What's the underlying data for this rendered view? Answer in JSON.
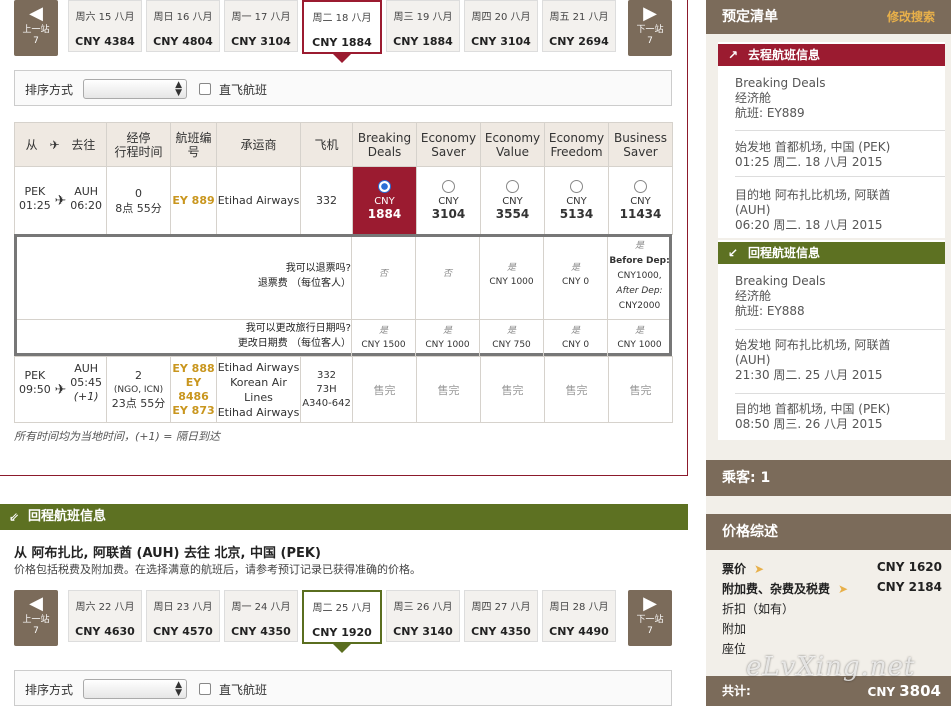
{
  "outbound_dates": {
    "prev_label": "上一站",
    "prev_num": "7",
    "next_label": "下一站",
    "next_num": "7",
    "items": [
      {
        "date": "周六 15 八月",
        "price": "CNY 4384"
      },
      {
        "date": "周日 16 八月",
        "price": "CNY 4804"
      },
      {
        "date": "周一 17 八月",
        "price": "CNY 3104"
      },
      {
        "date": "周二 18 八月",
        "price": "CNY 1884"
      },
      {
        "date": "周三 19 八月",
        "price": "CNY 1884"
      },
      {
        "date": "周四 20 八月",
        "price": "CNY 3104"
      },
      {
        "date": "周五 21 八月",
        "price": "CNY 2694"
      }
    ]
  },
  "sort": {
    "label": "排序方式",
    "direct_label": "直飞航班"
  },
  "table": {
    "h_from": "从",
    "h_to": "去往",
    "h_stops": "经停",
    "h_duration": "行程时间",
    "h_flightno": "航班编号",
    "h_carrier": "承运商",
    "h_aircraft": "飞机",
    "fares": [
      {
        "l1": "Breaking",
        "l2": "Deals"
      },
      {
        "l1": "Economy",
        "l2": "Saver"
      },
      {
        "l1": "Economy",
        "l2": "Value"
      },
      {
        "l1": "Economy",
        "l2": "Freedom"
      },
      {
        "l1": "Business",
        "l2": "Saver"
      }
    ],
    "row1": {
      "from": "PEK",
      "dep": "01:25",
      "to": "AUH",
      "arr": "06:20",
      "stops": "0",
      "duration": "8点 55分",
      "flight": "EY 889",
      "carrier": "Etihad Airways",
      "aircraft": "332",
      "prices": [
        {
          "cur": "CNY",
          "amt": "1884"
        },
        {
          "cur": "CNY",
          "amt": "3104"
        },
        {
          "cur": "CNY",
          "amt": "3554"
        },
        {
          "cur": "CNY",
          "amt": "5134"
        },
        {
          "cur": "CNY",
          "amt": "11434"
        }
      ]
    },
    "rules": {
      "refund_q": "我可以退票吗?",
      "refund_fee": "退票费 （每位客人）",
      "change_q": "我可以更改旅行日期吗?",
      "change_fee": "更改日期费 （每位客人）",
      "refund": [
        {
          "yn": "否",
          "fee": ""
        },
        {
          "yn": "否",
          "fee": ""
        },
        {
          "yn": "是",
          "fee": "CNY 1000"
        },
        {
          "yn": "是",
          "fee": "CNY 0"
        },
        {
          "yn": "是",
          "fee": "Before Dep: CNY1000, After Dep: CNY2000"
        }
      ],
      "change": [
        {
          "yn": "是",
          "fee": "CNY 1500"
        },
        {
          "yn": "是",
          "fee": "CNY 1000"
        },
        {
          "yn": "是",
          "fee": "CNY 750"
        },
        {
          "yn": "是",
          "fee": "CNY 0"
        },
        {
          "yn": "是",
          "fee": "CNY 1000"
        }
      ],
      "before_dep": "Before Dep:",
      "before_val": "CNY1000,",
      "after_dep": "After Dep:",
      "after_val": "CNY2000"
    },
    "row2": {
      "from": "PEK",
      "dep": "09:50",
      "to": "AUH",
      "arr": "05:45",
      "arr_note": "(+1)",
      "stops": "2",
      "via": "(NGO, ICN)",
      "duration": "23点 55分",
      "flights": [
        "EY 888",
        "EY",
        "8486",
        "EY 873"
      ],
      "carriers": [
        "Etihad Airways",
        "Korean Air",
        "Lines",
        "Etihad Airways"
      ],
      "aircraft": [
        "332",
        "73H",
        "A340-642"
      ],
      "sold": "售完"
    },
    "note": "所有时间均为当地时间，(+1) = 隔日到达"
  },
  "return": {
    "bar_label": "回程航班信息",
    "title": "从 阿布扎比, 阿联酋 (AUH) 去往 北京, 中国 (PEK)",
    "subtitle": "价格包括税费及附加费。在选择满意的航班后，请参考预订记录已获得准确的价格。",
    "dates": [
      {
        "date": "周六 22 八月",
        "price": "CNY 4630"
      },
      {
        "date": "周日 23 八月",
        "price": "CNY 4570"
      },
      {
        "date": "周一 24 八月",
        "price": "CNY 4350"
      },
      {
        "date": "周二 25 八月",
        "price": "CNY 1920"
      },
      {
        "date": "周三 26 八月",
        "price": "CNY 3140"
      },
      {
        "date": "周四 27 八月",
        "price": "CNY 4350"
      },
      {
        "date": "周日 28 八月",
        "price": "CNY 4490"
      }
    ]
  },
  "sidebar": {
    "title": "预定清单",
    "modify": "修改搜索",
    "outbound_bar": "去程航班信息",
    "out_fare": "Breaking Deals",
    "out_cabin": "经济舱",
    "out_flight": "航班:  EY889",
    "out_dep_l1": "始发地 首都机场, 中国 (PEK)",
    "out_dep_l2": "01:25 周二. 18 八月 2015",
    "out_arr_l1": "目的地 阿布扎比机场, 阿联酋",
    "out_arr_l2": "(AUH)",
    "out_arr_l3": "06:20 周二. 18 八月 2015",
    "return_bar": "回程航班信息",
    "ret_fare": "Breaking Deals",
    "ret_cabin": "经济舱",
    "ret_flight": "航班:  EY888",
    "ret_dep_l1": "始发地 阿布扎比机场, 阿联酋",
    "ret_dep_l2": "(AUH)",
    "ret_dep_l3": "21:30 周二. 25 八月 2015",
    "ret_arr_l1": "目的地 首都机场, 中国 (PEK)",
    "ret_arr_l2": "08:50 周三. 26 八月 2015",
    "passengers": "乘客: 1",
    "price_title": "价格综述",
    "fare_label": "票价",
    "fare_val": "CNY 1620",
    "tax_label": "附加费、杂费及税费",
    "tax_val": "CNY 2184",
    "discount_label": "折扣（如有）",
    "extra_label": "附加",
    "seat_label": "座位",
    "total_label": "共计:",
    "total_cur": "CNY",
    "total_val": "3804",
    "watermark": "eLvXing.net"
  }
}
